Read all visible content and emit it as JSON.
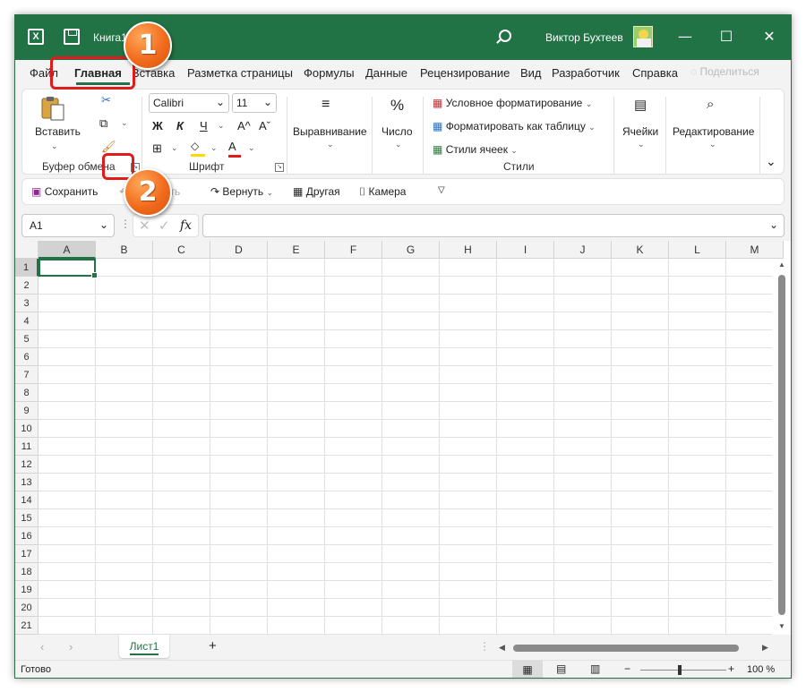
{
  "titlebar": {
    "app_icon": "excel-icon",
    "document_title": "Книга1",
    "user_name": "Виктор Бухтеев",
    "minimize": "—",
    "maximize": "☐",
    "close": "✕"
  },
  "menu": {
    "items": [
      "Файл",
      "Главная",
      "Вставка",
      "Разметка страницы",
      "Формулы",
      "Данные",
      "Рецензирование",
      "Вид",
      "Разработчик",
      "Справка"
    ],
    "active": "Главная",
    "share_label": "Поделиться"
  },
  "ribbon": {
    "clipboard": {
      "paste_label": "Вставить",
      "group_label": "Буфер обмена"
    },
    "font": {
      "name": "Calibri",
      "size": "11",
      "bold": "Ж",
      "italic": "К",
      "underline": "Ч",
      "grow": "A^",
      "shrink": "Aˇ",
      "color_letter": "A",
      "group_label": "Шрифт"
    },
    "alignment": {
      "label": "Выравнивание"
    },
    "number": {
      "symbol": "%",
      "label": "Число"
    },
    "styles": {
      "conditional": "Условное форматирование",
      "as_table": "Форматировать как таблицу",
      "cell_styles": "Стили ячеек",
      "group_label": "Стили"
    },
    "cells": {
      "label": "Ячейки"
    },
    "editing": {
      "label": "Редактирование"
    }
  },
  "qat": {
    "save": "Сохранить",
    "undo": "Отменить",
    "redo": "Вернуть",
    "other": "Другая",
    "camera": "Камера"
  },
  "formula_bar": {
    "cell_ref": "A1",
    "fx": "fx",
    "value": ""
  },
  "grid": {
    "columns": [
      "A",
      "B",
      "C",
      "D",
      "E",
      "F",
      "G",
      "H",
      "I",
      "J",
      "K",
      "L",
      "M"
    ],
    "rows": [
      "1",
      "2",
      "3",
      "4",
      "5",
      "6",
      "7",
      "8",
      "9",
      "10",
      "11",
      "12",
      "13",
      "14",
      "15",
      "16",
      "17",
      "18",
      "19",
      "20",
      "21"
    ],
    "selected_cell": "A1"
  },
  "sheets": {
    "tabs": [
      "Лист1"
    ],
    "add": "+"
  },
  "status": {
    "text": "Готово",
    "zoom": "100 %",
    "zoom_minus": "−",
    "zoom_plus": "+"
  },
  "callouts": {
    "one": "1",
    "two": "2"
  },
  "colors": {
    "excel_green": "#217346",
    "callout_orange": "#f26b1d",
    "highlight_red": "#e01b1b",
    "font_color_red": "#e01b1b",
    "fill_yellow": "#ffd800"
  }
}
